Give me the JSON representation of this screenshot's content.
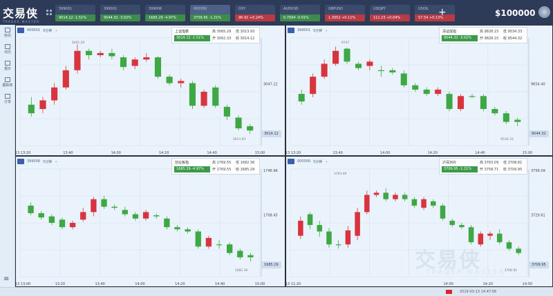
{
  "app": {
    "logo_cn": "交易侠",
    "logo_en": "TRADER MASTER",
    "balance": "$100000",
    "status_time": "2019-03-13 14:47:58"
  },
  "tabs": [
    {
      "name": "399001",
      "value": "9014.12  -1.51%",
      "dir": "down"
    },
    {
      "name": "399001",
      "value": "9544.32  -3.02%",
      "dir": "down"
    },
    {
      "name": "399006",
      "value": "1685.29  -4.97%",
      "dir": "down"
    },
    {
      "name": "000300",
      "value": "3709.95  -1.21%",
      "dir": "down",
      "active": true
    },
    {
      "name": "DXY",
      "value": "96.92  +0.24%",
      "dir": "up"
    },
    {
      "name": "AUDUSD",
      "value": "0.7094  -0.01%",
      "dir": "down"
    },
    {
      "name": "GBPUSD",
      "value": "1.3052  +0.11%",
      "dir": "up"
    },
    {
      "name": "USDJPY",
      "value": "111.23  +0.04%",
      "dir": "up"
    },
    {
      "name": "USOIL",
      "value": "57.54  +0.13%",
      "dir": "up"
    }
  ],
  "sidebar": [
    {
      "label": "快讯",
      "icon": "news-icon"
    },
    {
      "label": "日历",
      "icon": "calendar-icon"
    },
    {
      "label": "报价",
      "icon": "quote-icon"
    },
    {
      "label": "跟踪单",
      "icon": "trade-icon"
    },
    {
      "label": "订单",
      "icon": "order-icon"
    }
  ],
  "panes": [
    {
      "code": "000001",
      "period": "5分钟",
      "name": "上证指数",
      "price": "3014.12",
      "chg": "-1.51%",
      "high": "3065.29",
      "low": "3013.93",
      "open": "3062.33",
      "close": "3014.12",
      "ylabel_mid": "3047.22",
      "last": "3014.12",
      "xlabels": [
        "03/13 13:20",
        "13:40",
        "14:00",
        "14:20",
        "14:40",
        "15:00"
      ],
      "hi_note": "3065.29",
      "lo_note": "3013.93",
      "color": "#3b9b4b",
      "candles": [
        [
          0.62,
          0.7,
          0.55,
          0.73
        ],
        [
          0.66,
          0.58,
          0.55,
          0.7
        ],
        [
          0.58,
          0.46,
          0.42,
          0.62
        ],
        [
          0.46,
          0.3,
          0.26,
          0.48
        ],
        [
          0.3,
          0.12,
          0.06,
          0.33
        ],
        [
          0.12,
          0.16,
          0.1,
          0.2
        ],
        [
          0.16,
          0.14,
          0.12,
          0.18
        ],
        [
          0.14,
          0.17,
          0.1,
          0.2
        ],
        [
          0.18,
          0.27,
          0.16,
          0.3
        ],
        [
          0.26,
          0.2,
          0.18,
          0.29
        ],
        [
          0.2,
          0.18,
          0.14,
          0.22
        ],
        [
          0.18,
          0.36,
          0.17,
          0.38
        ],
        [
          0.36,
          0.42,
          0.34,
          0.44
        ],
        [
          0.42,
          0.4,
          0.38,
          0.46
        ],
        [
          0.42,
          0.63,
          0.4,
          0.66
        ],
        [
          0.63,
          0.5,
          0.48,
          0.65
        ],
        [
          0.46,
          0.63,
          0.44,
          0.65
        ],
        [
          0.64,
          0.73,
          0.62,
          0.76
        ],
        [
          0.74,
          0.84,
          0.72,
          0.86
        ],
        [
          0.82,
          0.86,
          0.8,
          0.89
        ]
      ]
    },
    {
      "code": "399001",
      "period": "5分钟",
      "name": "深证成指",
      "price": "9544.32",
      "chg": "-3.02%",
      "high": "9828.15",
      "low": "9534.33",
      "open": "9828.15",
      "close": "9544.32",
      "ylabel_mid": "9654.40",
      "last": "9544.32",
      "xlabels": [
        "03/13 13:20",
        "13:40",
        "14:00",
        "14:20",
        "14:40",
        "15:00"
      ],
      "hi_note": "9747",
      "lo_note": "9534.33",
      "color": "#3b9b4b",
      "candles": [
        [
          0.52,
          0.59,
          0.48,
          0.62
        ],
        [
          0.52,
          0.36,
          0.33,
          0.55
        ],
        [
          0.36,
          0.24,
          0.2,
          0.38
        ],
        [
          0.24,
          0.12,
          0.08,
          0.26
        ],
        [
          0.1,
          0.22,
          0.09,
          0.24
        ],
        [
          0.24,
          0.28,
          0.22,
          0.3
        ],
        [
          0.26,
          0.22,
          0.2,
          0.3
        ],
        [
          0.3,
          0.3,
          0.26,
          0.36
        ],
        [
          0.3,
          0.32,
          0.28,
          0.34
        ],
        [
          0.33,
          0.44,
          0.3,
          0.46
        ],
        [
          0.44,
          0.48,
          0.42,
          0.5
        ],
        [
          0.48,
          0.52,
          0.46,
          0.54
        ],
        [
          0.52,
          0.48,
          0.46,
          0.54
        ],
        [
          0.52,
          0.66,
          0.5,
          0.68
        ],
        [
          0.66,
          0.54,
          0.52,
          0.68
        ],
        [
          0.54,
          0.54,
          0.52,
          0.56
        ],
        [
          0.54,
          0.66,
          0.52,
          0.68
        ],
        [
          0.66,
          0.7,
          0.64,
          0.72
        ],
        [
          0.7,
          0.78,
          0.68,
          0.8
        ],
        [
          0.76,
          0.78,
          0.74,
          0.82
        ]
      ]
    },
    {
      "code": "399006",
      "period": "5分钟",
      "name": "创业板指",
      "price": "1685.29",
      "chg": "-4.97%",
      "high": "1769.55",
      "low": "1682.36",
      "open": "1769.55",
      "close": "1685.29",
      "ylabel_top": "1746.96",
      "ylabel_mid": "1708.45",
      "last": "1685.29",
      "xlabels": [
        "02/13 13:00",
        "13:20",
        "13:40",
        "14:00",
        "14:20",
        "14:40",
        "15:00"
      ],
      "lo_note": "1682.36",
      "color": "#3b9b4b",
      "candles": [
        [
          0.34,
          0.41,
          0.31,
          0.43
        ],
        [
          0.41,
          0.45,
          0.39,
          0.47
        ],
        [
          0.44,
          0.5,
          0.42,
          0.52
        ],
        [
          0.47,
          0.54,
          0.45,
          0.56
        ],
        [
          0.54,
          0.5,
          0.48,
          0.56
        ],
        [
          0.47,
          0.4,
          0.36,
          0.49
        ],
        [
          0.4,
          0.28,
          0.26,
          0.44
        ],
        [
          0.28,
          0.35,
          0.25,
          0.37
        ],
        [
          0.35,
          0.36,
          0.33,
          0.38
        ],
        [
          0.38,
          0.42,
          0.35,
          0.44
        ],
        [
          0.42,
          0.46,
          0.4,
          0.48
        ],
        [
          0.46,
          0.4,
          0.38,
          0.48
        ],
        [
          0.43,
          0.44,
          0.41,
          0.46
        ],
        [
          0.46,
          0.54,
          0.44,
          0.56
        ],
        [
          0.54,
          0.56,
          0.52,
          0.58
        ],
        [
          0.56,
          0.58,
          0.54,
          0.6
        ],
        [
          0.58,
          0.72,
          0.56,
          0.74
        ],
        [
          0.72,
          0.64,
          0.62,
          0.74
        ],
        [
          0.7,
          0.7,
          0.66,
          0.74
        ],
        [
          0.7,
          0.78,
          0.68,
          0.8
        ],
        [
          0.76,
          0.82,
          0.74,
          0.84
        ],
        [
          0.8,
          0.82,
          0.78,
          0.86
        ]
      ]
    },
    {
      "code": "000300",
      "period": "5分钟",
      "name": "沪深300",
      "price": "3709.95",
      "chg": "-1.21%",
      "high": "3763.09",
      "low": "3708.81",
      "open": "3758.71",
      "close": "3709.95",
      "ylabel_top": "3758.09",
      "ylabel_mid": "3729.61",
      "last": "3709.95",
      "xlabels": [
        "11/13 11:20",
        "",
        "",
        "",
        "14:00",
        "14:20",
        "14:50"
      ],
      "hi_note": "3763.09",
      "lo_note": "3708.81",
      "color": "#3b9b4b",
      "candles": [
        [
          0.62,
          0.48,
          0.44,
          0.65
        ],
        [
          0.42,
          0.52,
          0.4,
          0.56
        ],
        [
          0.52,
          0.58,
          0.48,
          0.63
        ],
        [
          0.58,
          0.7,
          0.55,
          0.73
        ],
        [
          0.7,
          0.7,
          0.66,
          0.74
        ],
        [
          0.7,
          0.57,
          0.53,
          0.73
        ],
        [
          0.62,
          0.4,
          0.36,
          0.66
        ],
        [
          0.4,
          0.24,
          0.2,
          0.42
        ],
        [
          0.24,
          0.22,
          0.2,
          0.26
        ],
        [
          0.22,
          0.28,
          0.18,
          0.3
        ],
        [
          0.28,
          0.24,
          0.22,
          0.3
        ],
        [
          0.24,
          0.28,
          0.22,
          0.3
        ],
        [
          0.28,
          0.34,
          0.26,
          0.36
        ],
        [
          0.36,
          0.28,
          0.26,
          0.38
        ],
        [
          0.3,
          0.34,
          0.28,
          0.36
        ],
        [
          0.34,
          0.46,
          0.32,
          0.48
        ],
        [
          0.48,
          0.52,
          0.46,
          0.54
        ],
        [
          0.52,
          0.54,
          0.5,
          0.56
        ],
        [
          0.54,
          0.68,
          0.52,
          0.7
        ],
        [
          0.7,
          0.6,
          0.58,
          0.72
        ],
        [
          0.62,
          0.6,
          0.58,
          0.66
        ],
        [
          0.6,
          0.68,
          0.56,
          0.7
        ],
        [
          0.68,
          0.74,
          0.66,
          0.76
        ],
        [
          0.74,
          0.78,
          0.72,
          0.8
        ]
      ]
    }
  ]
}
